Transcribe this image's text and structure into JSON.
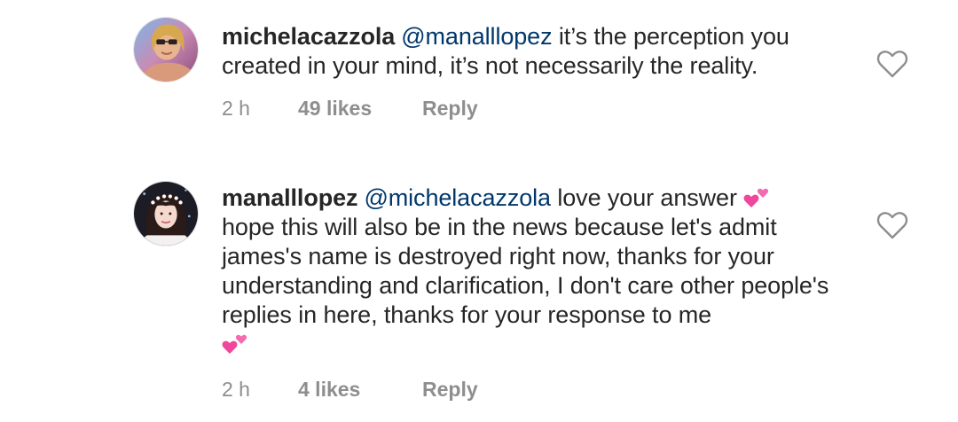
{
  "comments": [
    {
      "username": "michelacazzola",
      "mention": "@manalllopez",
      "text": "it’s the perception you created in your mind, it’s not necessarily the reality.",
      "time": "2 h",
      "likes": "49 likes",
      "reply_label": "Reply",
      "avatar_icon": "profile-photo-sunglasses",
      "like_icon": "heart-outline-icon"
    },
    {
      "username": "manalllopez",
      "mention": "@michelacazzola",
      "text_line1": "love your answer",
      "text_rest": "hope this will also be in the news because let's admit james's name is destroyed right now, thanks for your understanding and clarification, I don't care other people's replies in here, thanks for your response to me",
      "emoji": "two-hearts-emoji",
      "time": "2 h",
      "likes": "4 likes",
      "reply_label": "Reply",
      "avatar_icon": "profile-photo-flower-crown",
      "like_icon": "heart-outline-icon"
    }
  ],
  "colors": {
    "text": "#262626",
    "mention": "#00376b",
    "meta": "#8e8e8e",
    "emoji_pink": "#f0469b"
  }
}
